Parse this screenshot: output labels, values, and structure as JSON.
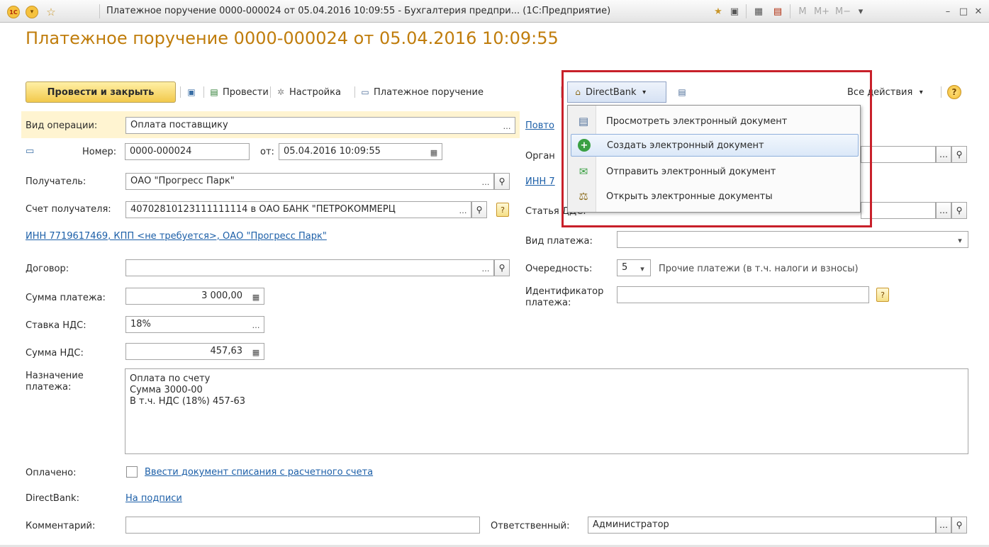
{
  "window": {
    "title": "Платежное поручение 0000-000024 от 05.04.2016 10:09:55 - Бухгалтерия предпри... (1С:Предприятие)",
    "m_label": "M",
    "m_plus_label": "M+",
    "m_minus_label": "M−"
  },
  "doc_title": "Платежное поручение 0000-000024 от 05.04.2016 10:09:55",
  "toolbar": {
    "post_close": "Провести и закрыть",
    "post": "Провести",
    "settings": "Настройка",
    "print": "Платежное поручение",
    "directbank": "DirectBank",
    "all_actions": "Все действия",
    "help": "?"
  },
  "menu": {
    "items": [
      {
        "label": "Просмотреть электронный документ",
        "icon": "document-icon"
      },
      {
        "label": "Создать электронный документ",
        "icon": "add-icon"
      },
      {
        "label": "Отправить электронный документ",
        "icon": "send-icon"
      },
      {
        "label": "Открыть электронные документы",
        "icon": "documents-icon"
      }
    ],
    "active_index": 1
  },
  "form": {
    "operation": {
      "label": "Вид операции:",
      "value": "Оплата поставщику"
    },
    "number": {
      "label": "Номер:",
      "value": "0000-000024",
      "date_label": "от:",
      "date_value": "05.04.2016 10:09:55"
    },
    "recipient": {
      "label": "Получатель:",
      "value": "ОАО \"Прогресс Парк\""
    },
    "account": {
      "label": "Счет получателя:",
      "value": "40702810123111111114 в ОАО БАНК \"ПЕТРОКОММЕРЦ"
    },
    "inn_link": "ИНН 7719617469, КПП <не требуется>, ОАО \"Прогресс Парк\"",
    "contract": {
      "label": "Договор:",
      "value": ""
    },
    "amount": {
      "label": "Сумма платежа:",
      "value": "3 000,00"
    },
    "vat_rate": {
      "label": "Ставка НДС:",
      "value": "18%"
    },
    "vat_amount": {
      "label": "Сумма НДС:",
      "value": "457,63"
    },
    "purpose": {
      "label": "Назначение платежа:",
      "lines": [
        "Оплата по счету",
        "Сумма 3000-00",
        "В т.ч. НДС  (18%) 457-63"
      ]
    },
    "paid": {
      "label": "Оплачено:",
      "link": "Ввести документ списания с расчетного счета"
    },
    "directbank": {
      "label": "DirectBank:",
      "link": "На подписи"
    },
    "comment": {
      "label": "Комментарий:",
      "value": ""
    },
    "right": {
      "repeat_link": "Повто",
      "org_label": "Орган",
      "inn_link": "ИНН 7",
      "article_label": "Статья ДДС:",
      "payment_type": {
        "label": "Вид платежа:",
        "value": ""
      },
      "priority": {
        "label": "Очередность:",
        "value": "5",
        "note": "Прочие платежи (в т.ч. налоги и взносы)"
      },
      "identifier": {
        "label": "Идентификатор платежа:",
        "value": ""
      },
      "responsible": {
        "label": "Ответственный:",
        "value": "Администратор"
      }
    }
  }
}
